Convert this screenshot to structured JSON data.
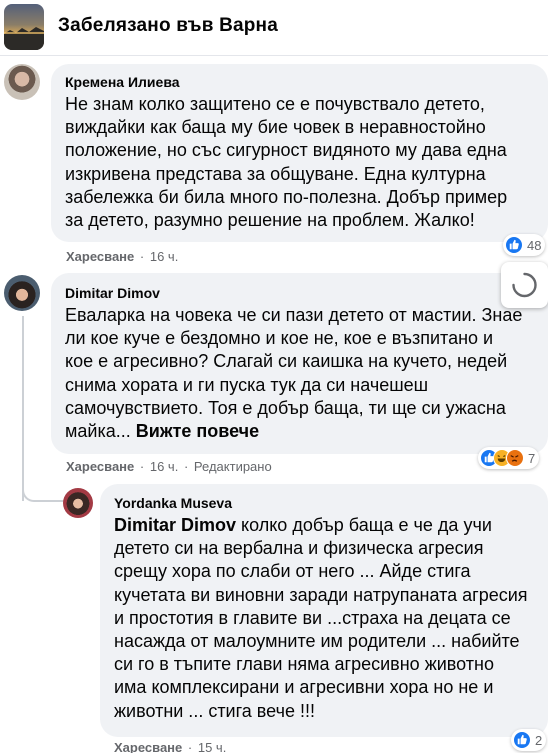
{
  "group": {
    "title": "Забелязано във Варна"
  },
  "comments": [
    {
      "author": "Кремена Илиева",
      "lines": [
        "Не знам колко защитено се е почувствало детето,",
        "виждайки как баща му бие човек в неравностойно",
        "положение, но със сигурност видяното му дава една",
        "изкривена представа за общуване. Една културна",
        "забележка би била много по-полезна. Добър пример",
        "за детето, разумно решение на проблем. Жалко!"
      ],
      "like_label": "Харесване",
      "time": "16 ч.",
      "reaction_count": "48"
    },
    {
      "author": "Dimitar Dimov",
      "lines": [
        "Еваларка на човека че си пази детето от мастии. Знае",
        "ли кое куче е бездомно и кое не, кое е възпитано и",
        "кое е агресивно? Слагай си каишка на кучето, недей",
        "снима хората и ги пуска тук да си начешеш",
        "самочувствието. Тоя е добър баща, ти ще си ужасна",
        "майка..."
      ],
      "see_more": "Вижте повече",
      "like_label": "Харесване",
      "time": "16 ч.",
      "edited": "Редактирано",
      "reaction_count": "7"
    },
    {
      "author": "Yordanka Museva",
      "mention": "Dimitar Dimov",
      "first_line_rest": " колко добър баща е че да учи",
      "lines": [
        "детето си на вербална и физическа агресия",
        "срещу хора по слаби от него ... Айде стига",
        "кучетата ви виновни заради натрупаната агресия",
        "и простотия в главите ви ...страха на децата се",
        "насажда от малоумните им родители ... набийте",
        "си го в тъпите глави няма агресивно животно",
        "има комплексирани и агресивни хора но не и",
        "животни ... стига вече !!!"
      ],
      "like_label": "Харесване",
      "time": "15 ч.",
      "reaction_count": "2"
    }
  ],
  "colors": {
    "like_blue": "#1877f2",
    "haha_yellow": "#f7b125",
    "angry_orange": "#e9710f",
    "bubble_bg": "#f0f2f5",
    "meta_gray": "#65676b"
  },
  "icons": [
    "group-cover-icon",
    "like-reaction-icon",
    "haha-reaction-icon",
    "angry-reaction-icon",
    "loading-spinner-icon"
  ]
}
